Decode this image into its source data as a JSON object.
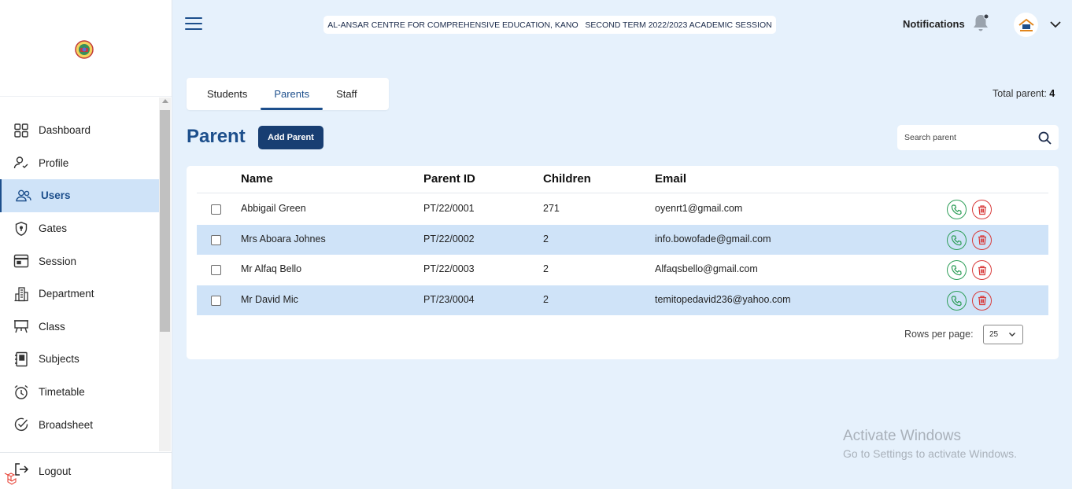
{
  "header": {
    "school_session": "AL-ANSAR CENTRE FOR COMPREHENSIVE EDUCATION, KANO   SECOND TERM 2022/2023 ACADEMIC SESSION",
    "notifications_label": "Notifications"
  },
  "sidebar": {
    "items": [
      {
        "label": "Dashboard",
        "icon": "dashboard-icon"
      },
      {
        "label": "Profile",
        "icon": "profile-icon"
      },
      {
        "label": "Users",
        "icon": "users-icon",
        "active": true
      },
      {
        "label": "Gates",
        "icon": "shield-icon"
      },
      {
        "label": "Session",
        "icon": "calendar-icon"
      },
      {
        "label": "Department",
        "icon": "building-icon"
      },
      {
        "label": "Class",
        "icon": "easel-icon"
      },
      {
        "label": "Subjects",
        "icon": "book-icon"
      },
      {
        "label": "Timetable",
        "icon": "alarm-clock-icon"
      },
      {
        "label": "Broadsheet",
        "icon": "check-circle-icon"
      }
    ],
    "logout_label": "Logout"
  },
  "tabs": [
    {
      "label": "Students"
    },
    {
      "label": "Parents",
      "active": true
    },
    {
      "label": "Staff"
    }
  ],
  "summary": {
    "total_label": "Total parent:",
    "total_value": "4"
  },
  "page": {
    "title": "Parent",
    "add_button": "Add Parent",
    "search_placeholder": "Search parent"
  },
  "table": {
    "columns": [
      "Name",
      "Parent ID",
      "Children",
      "Email"
    ],
    "rows": [
      {
        "name": "Abbigail Green",
        "parent_id": "PT/22/0001",
        "children": "271",
        "email": "oyenrt1@gmail.com"
      },
      {
        "name": "Mrs Aboara Johnes",
        "parent_id": "PT/22/0002",
        "children": "2",
        "email": "info.bowofade@gmail.com"
      },
      {
        "name": "Mr Alfaq Bello",
        "parent_id": "PT/22/0003",
        "children": "2",
        "email": "Alfaqsbello@gmail.com"
      },
      {
        "name": "Mr David Mic",
        "parent_id": "PT/23/0004",
        "children": "2",
        "email": "temitopedavid236@yahoo.com"
      }
    ]
  },
  "pagination": {
    "rows_per_page_label": "Rows per page:",
    "rows_per_page_value": "25"
  },
  "watermark": {
    "line1": "Activate Windows",
    "line2": "Go to Settings to activate Windows."
  },
  "colors": {
    "primary": "#1d4f8c",
    "button": "#183e72",
    "background": "#e6f1fc",
    "row_highlight": "#cfe3f8",
    "call": "#2e9e58",
    "delete": "#d83a3a"
  }
}
